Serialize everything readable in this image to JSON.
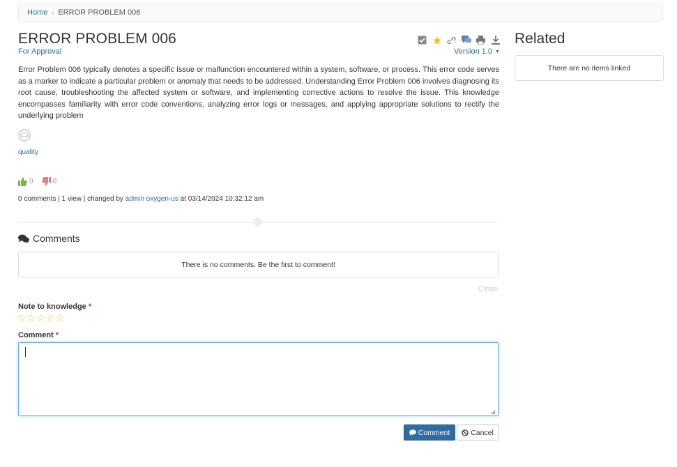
{
  "breadcrumb": {
    "home": "Home",
    "separator": "›",
    "current": "ERROR PROBLEM 006"
  },
  "article": {
    "title": "ERROR PROBLEM 006",
    "status": "For Approval",
    "version": "Version 1.0",
    "description": "Error Problem 006 typically denotes a specific issue or malfunction encountered within a system, software, or process. This error code serves as a marker to indicate a particular problem or anomaly that needs to be addressed. Understanding Error Problem 006 involves diagnosing its root cause, troubleshooting the affected system or software, and implementing corrective actions to resolve the issue. This knowledge encompasses familiarity with error code conventions, analyzing error logs or messages, and applying appropriate solutions to rectify the underlying problem",
    "tag": "quality",
    "likes": "0",
    "dislikes": "0"
  },
  "toolbar": {
    "icons": [
      "checkbox-icon",
      "star-icon",
      "link-icon",
      "chat-icon",
      "print-icon",
      "download-icon"
    ]
  },
  "meta": {
    "comments": "0 comments",
    "views": "1 view",
    "changed_by_prefix": "changed by",
    "author": "admin oxygen-us",
    "changed_at": "at 03/14/2024 10:32:12 am",
    "sep": "|"
  },
  "comments": {
    "heading": "Comments",
    "empty_message": "There is no comments. Be the first to comment!",
    "close_label": "Close",
    "note_label": "Note to knowledge",
    "comment_label": "Comment",
    "required_marker": "*",
    "comment_value": "",
    "submit_label": "Comment",
    "cancel_label": "Cancel",
    "stars": [
      "☆",
      "☆",
      "☆",
      "☆",
      "☆"
    ]
  },
  "related": {
    "title": "Related",
    "empty_message": "There are no items linked"
  },
  "colors": {
    "link": "#2a6f97",
    "primary_button": "#2e6ca4",
    "star": "#e8c547",
    "required": "#c0392b"
  }
}
